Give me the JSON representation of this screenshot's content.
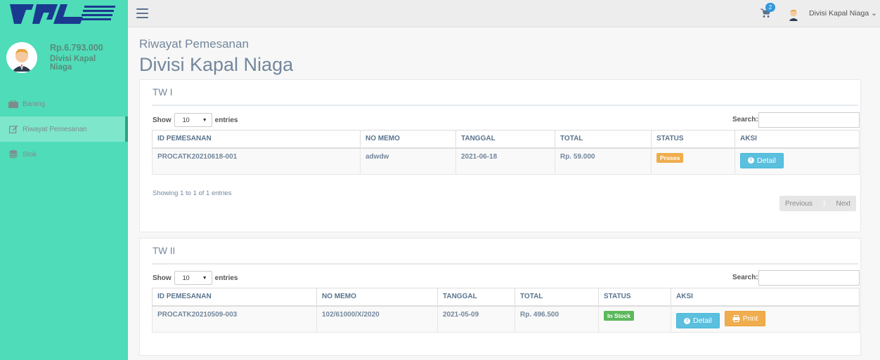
{
  "app": {
    "logo_text": "PAL"
  },
  "profile": {
    "balance": "Rp.6.793.000",
    "division": "Divisi Kapal Niaga"
  },
  "sidebar": {
    "items": [
      {
        "label": "Barang",
        "icon": "briefcase-icon",
        "active": false
      },
      {
        "label": "Riwayat Pemesanan",
        "icon": "edit-icon",
        "active": true
      },
      {
        "label": "Stok",
        "icon": "database-icon",
        "active": false
      }
    ]
  },
  "topbar": {
    "cart_count": "2",
    "user_name": "Divisi Kapal Niaga"
  },
  "header": {
    "subtitle": "Riwayat Pemesanan",
    "title": "Divisi Kapal Niaga"
  },
  "panels": [
    {
      "title": "TW I",
      "show_label": "Show",
      "entries_value": "10",
      "entries_label": "entries",
      "search_label": "Search:",
      "columns": [
        "ID PEMESANAN",
        "NO MEMO",
        "TANGGAL",
        "TOTAL",
        "STATUS",
        "AKSI"
      ],
      "rows": [
        {
          "id": "PROCATK20210618-001",
          "memo": "adwdw",
          "date": "2021-06-18",
          "total": "Rp. 59.000",
          "status": "Proses",
          "detail": "Detail"
        }
      ],
      "info": "Showing 1 to 1 of 1 entries",
      "pagination": {
        "previous": "Previous",
        "current": "1",
        "next": "Next"
      }
    },
    {
      "title": "TW II",
      "show_label": "Show",
      "entries_value": "10",
      "entries_label": "entries",
      "search_label": "Search:",
      "columns": [
        "ID PEMESANAN",
        "NO MEMO",
        "TANGGAL",
        "TOTAL",
        "STATUS",
        "AKSI"
      ],
      "rows": [
        {
          "id": "PROCATK20210509-003",
          "memo": "102/61000/X/2020",
          "date": "2021-05-09",
          "total": "Rp. 496.500",
          "status": "In Stock",
          "detail": "Detail",
          "print": "Print"
        }
      ]
    }
  ],
  "colors": {
    "sidebar": "#4fdcb8",
    "status_proses": "#f0ad4e",
    "status_in_stock": "#5cb85c",
    "btn_info": "#5bc0de",
    "btn_warning": "#f0ad4e"
  }
}
